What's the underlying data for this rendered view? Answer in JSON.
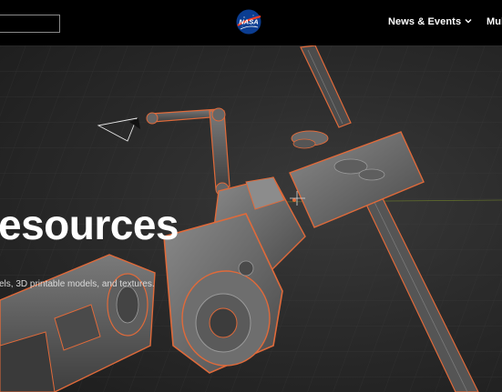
{
  "header": {
    "search": {
      "value": "",
      "placeholder": ""
    },
    "logo_text": "NASA",
    "nav": [
      {
        "label": "News & Events",
        "has_dropdown": true,
        "icon": "chevron-down-icon"
      },
      {
        "label": "Mul"
      }
    ]
  },
  "hero": {
    "title": "esources",
    "subtitle": "els, 3D printable models, and textures."
  },
  "colors": {
    "topbar": "#000000",
    "hero_background": "#2b2b2b",
    "model_outline": "#e06a3a",
    "text": "#ffffff"
  }
}
